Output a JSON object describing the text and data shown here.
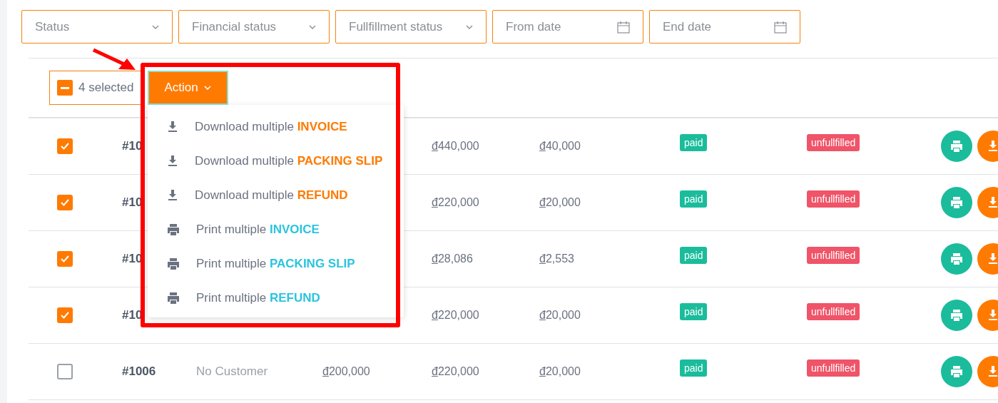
{
  "filters": [
    {
      "kind": "select",
      "placeholder": "Status"
    },
    {
      "kind": "select",
      "placeholder": "Financial status"
    },
    {
      "kind": "select",
      "placeholder": "Fullfillment status"
    },
    {
      "kind": "date",
      "placeholder": "From date"
    },
    {
      "kind": "date",
      "placeholder": "End date"
    }
  ],
  "bulk_bar": {
    "partial_selection": true,
    "selected_count": "4 selected",
    "action_button": "Action"
  },
  "action_menu": [
    {
      "kind": "download",
      "label": "Download multiple ",
      "target": "INVOICE"
    },
    {
      "kind": "download",
      "label": "Download multiple ",
      "target": "PACKING SLIP"
    },
    {
      "kind": "download",
      "label": "Download multiple ",
      "target": "REFUND"
    },
    {
      "kind": "print",
      "label": "Print multiple ",
      "target": "INVOICE"
    },
    {
      "kind": "print",
      "label": "Print multiple ",
      "target": "PACKING SLIP"
    },
    {
      "kind": "print",
      "label": "Print multiple ",
      "target": "REFUND"
    }
  ],
  "rows": [
    {
      "checked": true,
      "order": "#10",
      "total": "đ440,000",
      "shipping": "đ40,000",
      "financial": "paid",
      "fulfillment": "unfullfilled"
    },
    {
      "checked": true,
      "order": "#10",
      "total": "đ220,000",
      "shipping": "đ20,000",
      "financial": "paid",
      "fulfillment": "unfullfilled"
    },
    {
      "checked": true,
      "order": "#10",
      "total": "đ28,086",
      "shipping": "đ2,553",
      "financial": "paid",
      "fulfillment": "unfullfilled"
    },
    {
      "checked": true,
      "order": "#10",
      "total": "đ220,000",
      "shipping": "đ20,000",
      "financial": "paid",
      "fulfillment": "unfullfilled"
    },
    {
      "checked": false,
      "order": "#1006",
      "customer": "No Customer",
      "subtotal": "đ200,000",
      "total": "đ220,000",
      "shipping": "đ20,000",
      "financial": "paid",
      "fulfillment": "unfullfilled"
    }
  ]
}
